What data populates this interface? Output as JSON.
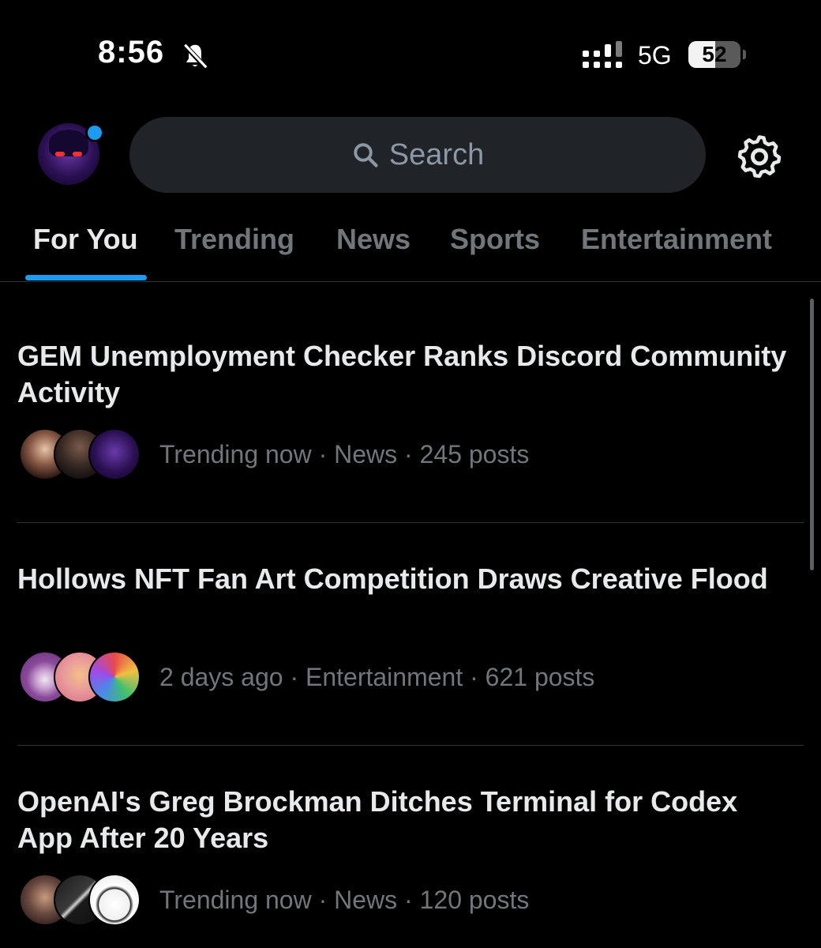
{
  "status_bar": {
    "time": "8:56",
    "network": "5G",
    "battery_percent": "52",
    "battery_level": 0.52
  },
  "header": {
    "search_placeholder": "Search"
  },
  "tabs": [
    {
      "label": "For You",
      "active": true
    },
    {
      "label": "Trending",
      "active": false
    },
    {
      "label": "News",
      "active": false
    },
    {
      "label": "Sports",
      "active": false
    },
    {
      "label": "Entertainment",
      "active": false
    }
  ],
  "feed": [
    {
      "headline": "GEM Unemployment Checker Ranks Discord Community Activity",
      "time": "Trending now",
      "category": "News",
      "posts": "245 posts"
    },
    {
      "headline": "Hollows NFT Fan Art Competition Draws Creative Flood",
      "time": "2 days ago",
      "category": "Entertainment",
      "posts": "621 posts"
    },
    {
      "headline": "OpenAI's Greg Brockman Ditches Terminal for Codex App After 20 Years",
      "time": "Trending now",
      "category": "News",
      "posts": "120 posts"
    }
  ],
  "colors": {
    "accent": "#1d9bf0",
    "background": "#000000",
    "primary_text": "#e7e9ea",
    "secondary_text": "#71767b",
    "search_bg": "#202327"
  },
  "icons": {
    "bell": "bell-slash-icon",
    "signal": "cellular-signal-icon",
    "search": "search-icon",
    "settings": "gear-icon"
  }
}
